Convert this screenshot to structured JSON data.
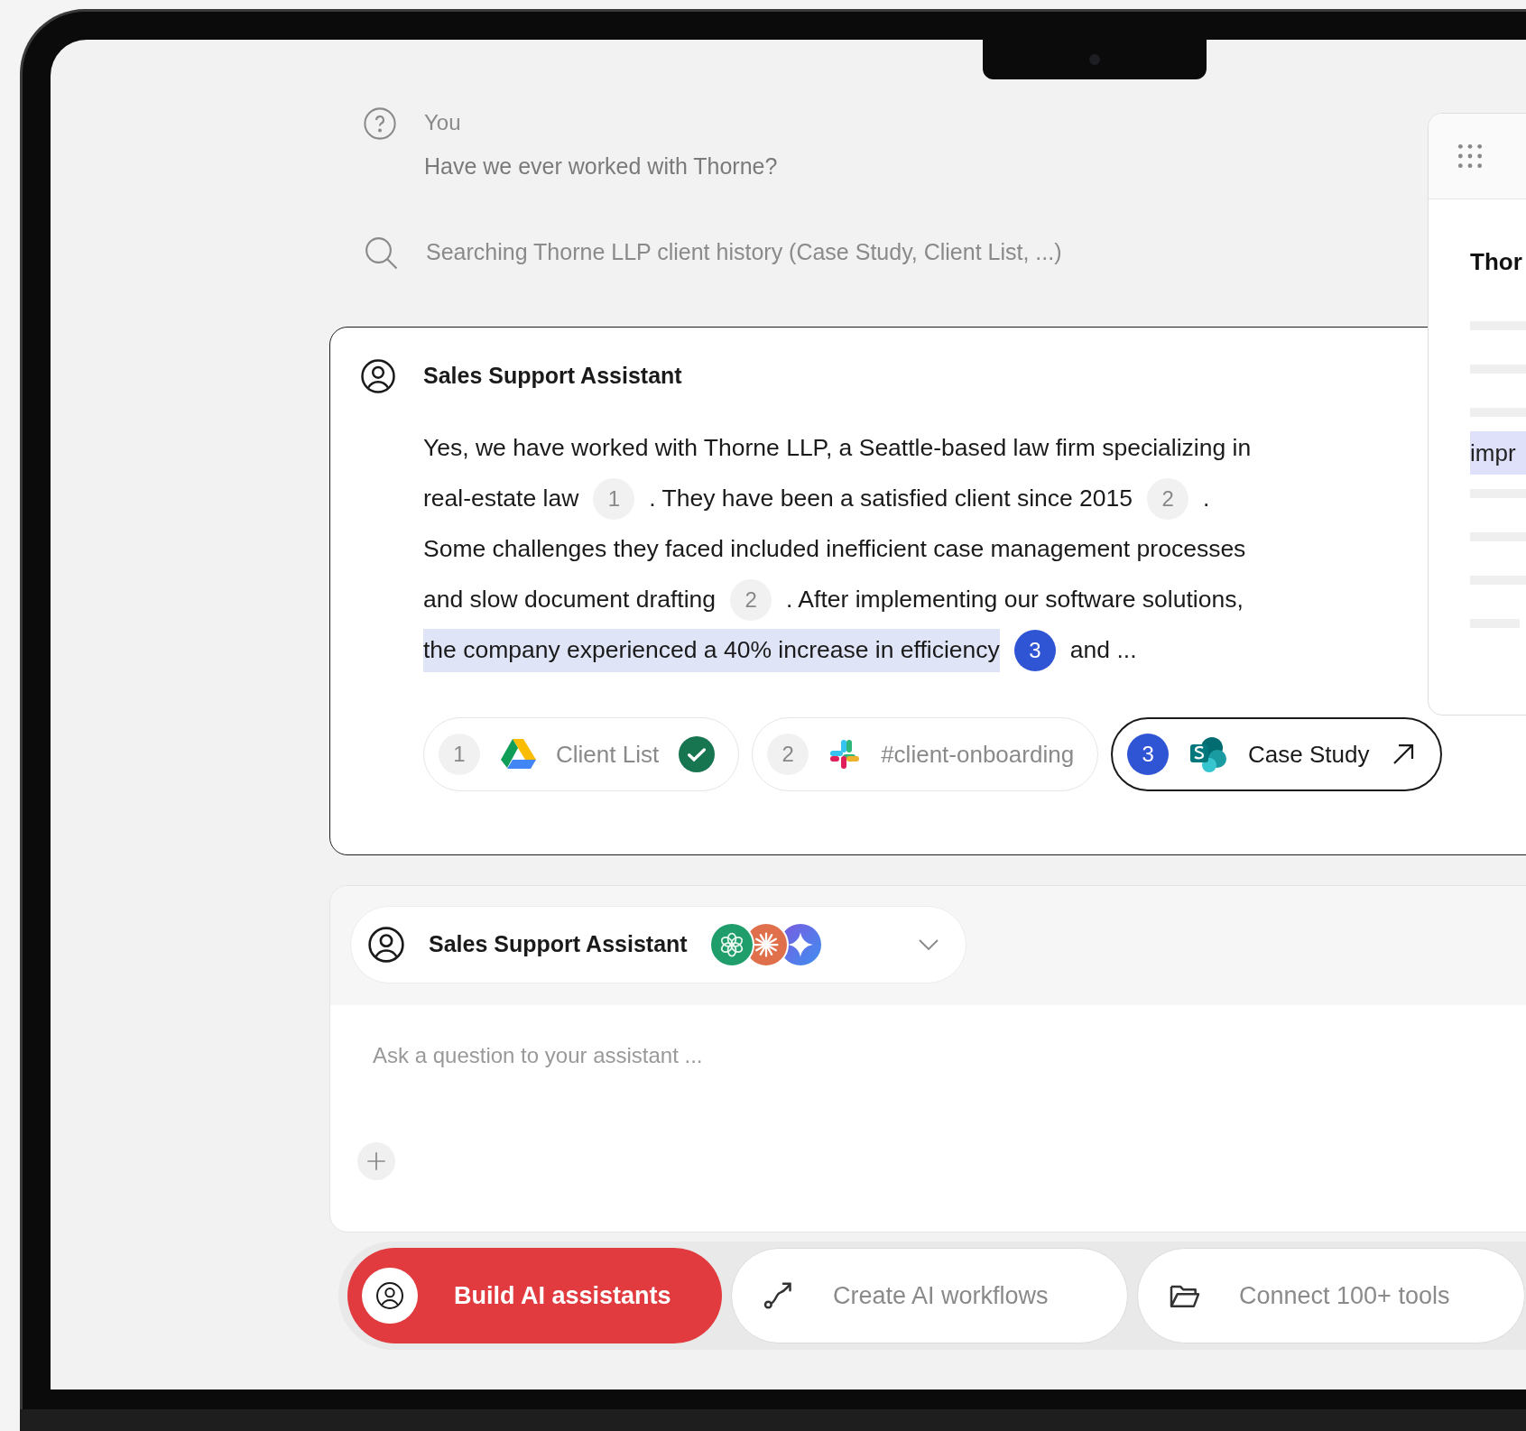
{
  "conversation": {
    "user": {
      "name": "You",
      "message": "Have we ever worked with Thorne?"
    },
    "search_status": "Searching Thorne LLP client history (Case Study, Client List, ...)",
    "answer": {
      "assistant": "Sales Support Assistant",
      "lines": [
        [
          {
            "kind": "text",
            "text": "Yes, we have worked with Thorne LLP, a Seattle-based law firm specializing in",
            "highlighted": false
          }
        ],
        [
          {
            "kind": "text",
            "text": "real-estate law",
            "highlighted": false
          },
          {
            "kind": "citation",
            "label": "1",
            "selected": false
          },
          {
            "kind": "text",
            "text": ". They have been a satisfied client since 2015",
            "highlighted": false
          },
          {
            "kind": "citation",
            "label": "2",
            "selected": false
          },
          {
            "kind": "text",
            "text": ".",
            "highlighted": false
          }
        ],
        [
          {
            "kind": "text",
            "text": "Some challenges they faced included inefficient case management processes",
            "highlighted": false
          }
        ],
        [
          {
            "kind": "text",
            "text": "and slow document drafting",
            "highlighted": false
          },
          {
            "kind": "citation",
            "label": "2",
            "selected": false
          },
          {
            "kind": "text",
            "text": ". After implementing our software solutions,",
            "highlighted": false
          }
        ],
        [
          {
            "kind": "text",
            "text": "the company experienced a 40% increase in efficiency",
            "highlighted": true
          },
          {
            "kind": "citation",
            "label": "3",
            "selected": true
          },
          {
            "kind": "text",
            "text": "and ...",
            "highlighted": false
          }
        ]
      ],
      "sources": [
        {
          "number": "1",
          "label": "Client List",
          "verified": true,
          "selected": false
        },
        {
          "number": "2",
          "label": "#client-onboarding",
          "verified": false,
          "selected": false
        },
        {
          "number": "3",
          "label": "Case Study",
          "verified": false,
          "selected": true
        }
      ]
    }
  },
  "preview_panel": {
    "title": "Thor",
    "highlight": "impr"
  },
  "composer": {
    "assistant": "Sales Support Assistant",
    "models": [
      {
        "kind": "openai"
      },
      {
        "kind": "anthropic"
      },
      {
        "kind": "gemini"
      }
    ],
    "placeholder": "Ask a question to your assistant ..."
  },
  "feature_tabs": [
    {
      "label": "Build AI assistants",
      "selected": true
    },
    {
      "label": "Create AI workflows",
      "selected": false
    },
    {
      "label": "Connect 100+ tools",
      "selected": false
    }
  ]
}
